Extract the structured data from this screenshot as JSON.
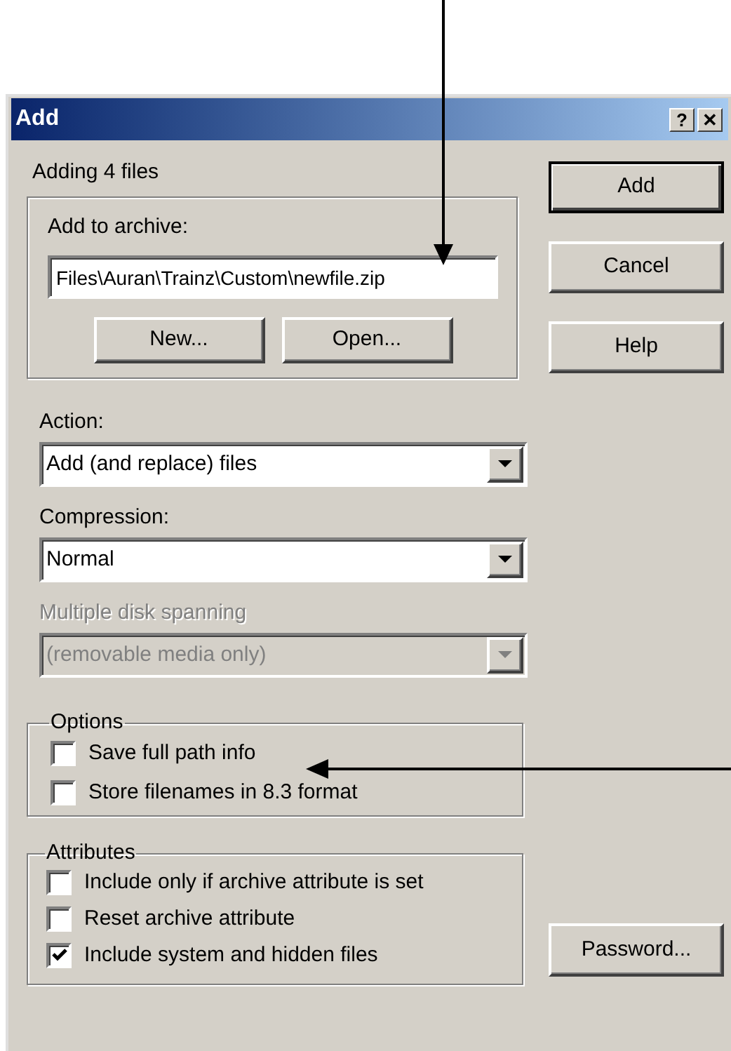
{
  "window": {
    "title": "Add",
    "title_buttons": [
      "?",
      "✕"
    ]
  },
  "summary": "Adding 4 files",
  "archive_group": {
    "label": "Add to archive:",
    "value": "Files\\Auran\\Trainz\\Custom\\newfile.zip",
    "buttons": [
      "New...",
      "Open..."
    ]
  },
  "fields": [
    {
      "label": "Action:",
      "value": "Add (and replace) files",
      "disabled": false
    },
    {
      "label": "Compression:",
      "value": "Normal",
      "disabled": false
    },
    {
      "label": "Multiple disk spanning",
      "value": "(removable media only)",
      "disabled": true
    }
  ],
  "options": {
    "title": "Options",
    "items": [
      {
        "label": "Save full path info",
        "checked": false
      },
      {
        "label": "Store filenames in 8.3 format",
        "checked": false
      }
    ]
  },
  "attributes": {
    "title": "Attributes",
    "items": [
      {
        "label": "Include only if archive attribute is set",
        "checked": false
      },
      {
        "label": "Reset archive attribute",
        "checked": false
      },
      {
        "label": "Include system and hidden files",
        "checked": true
      }
    ]
  },
  "buttons": [
    {
      "label": "Add",
      "default": true
    },
    {
      "label": "Cancel",
      "default": false
    },
    {
      "label": "Help",
      "default": false
    }
  ],
  "password_button": "Password..."
}
